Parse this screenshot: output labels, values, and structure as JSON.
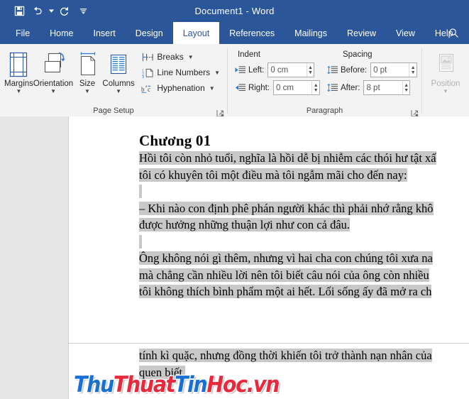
{
  "window": {
    "title": "Document1  -  Word",
    "quick_access": [
      {
        "name": "save",
        "icon": "save-icon"
      },
      {
        "name": "undo",
        "icon": "undo-icon"
      },
      {
        "name": "redo",
        "icon": "redo-icon"
      },
      {
        "name": "customize",
        "icon": "customize-qat-icon"
      }
    ]
  },
  "tabs": [
    {
      "label": "File",
      "active": false
    },
    {
      "label": "Home",
      "active": false
    },
    {
      "label": "Insert",
      "active": false
    },
    {
      "label": "Design",
      "active": false
    },
    {
      "label": "Layout",
      "active": true
    },
    {
      "label": "References",
      "active": false
    },
    {
      "label": "Mailings",
      "active": false
    },
    {
      "label": "Review",
      "active": false
    },
    {
      "label": "View",
      "active": false
    },
    {
      "label": "Help",
      "active": false
    }
  ],
  "search": {
    "icon": "search-icon"
  },
  "ribbon": {
    "page_setup": {
      "label": "Page Setup",
      "buttons": [
        {
          "label": "Margins",
          "icon": "margins-icon"
        },
        {
          "label": "Orientation",
          "icon": "orientation-icon"
        },
        {
          "label": "Size",
          "icon": "size-icon"
        },
        {
          "label": "Columns",
          "icon": "columns-icon"
        }
      ],
      "small_buttons": [
        {
          "label": "Breaks",
          "icon": "breaks-icon"
        },
        {
          "label": "Line Numbers",
          "icon": "line-numbers-icon"
        },
        {
          "label": "Hyphenation",
          "icon": "hyphenation-icon"
        }
      ]
    },
    "paragraph": {
      "label": "Paragraph",
      "indent_header": "Indent",
      "spacing_header": "Spacing",
      "indent_left_label": "Left:",
      "indent_left_value": "0 cm",
      "indent_right_label": "Right:",
      "indent_right_value": "0 cm",
      "spacing_before_label": "Before:",
      "spacing_before_value": "0 pt",
      "spacing_after_label": "After:",
      "spacing_after_value": "8 pt"
    },
    "arrange": {
      "position_label": "Position",
      "position_icon": "position-icon",
      "position_disabled": true
    }
  },
  "document": {
    "heading": "Chương 01",
    "paragraphs": [
      "Hồi tôi còn nhỏ tuổi, nghĩa là hồi dễ bị nhiễm các thói hư tật xấ",
      "tôi có khuyên tôi một điều mà tôi ngẫm mãi cho đến nay:",
      "– Khi nào con định phê phán người khác thì phải nhớ rằng khô",
      "được hưởng những thuận lợi như con cả đâu.",
      "Ông không nói gì thêm, nhưng vì hai cha con chúng tôi xưa na",
      "mà chẳng cần nhiều lời nên tôi biết câu nói của ông còn nhiều",
      "tôi không thích bình phẩm một ai hết. Lối sống ấy đã mở ra ch",
      "tính kì quặc, nhưng đồng thời khiến tôi trở thành nạn nhân của",
      "quen biết."
    ],
    "selection_color": "#c8c8c8"
  },
  "watermark": {
    "part1": "Thu",
    "part2": "Thuat",
    "part3": "Tin",
    "part4": "Hoc.vn",
    "color_blue": "#1a6fd4",
    "color_red": "#e8293c"
  }
}
